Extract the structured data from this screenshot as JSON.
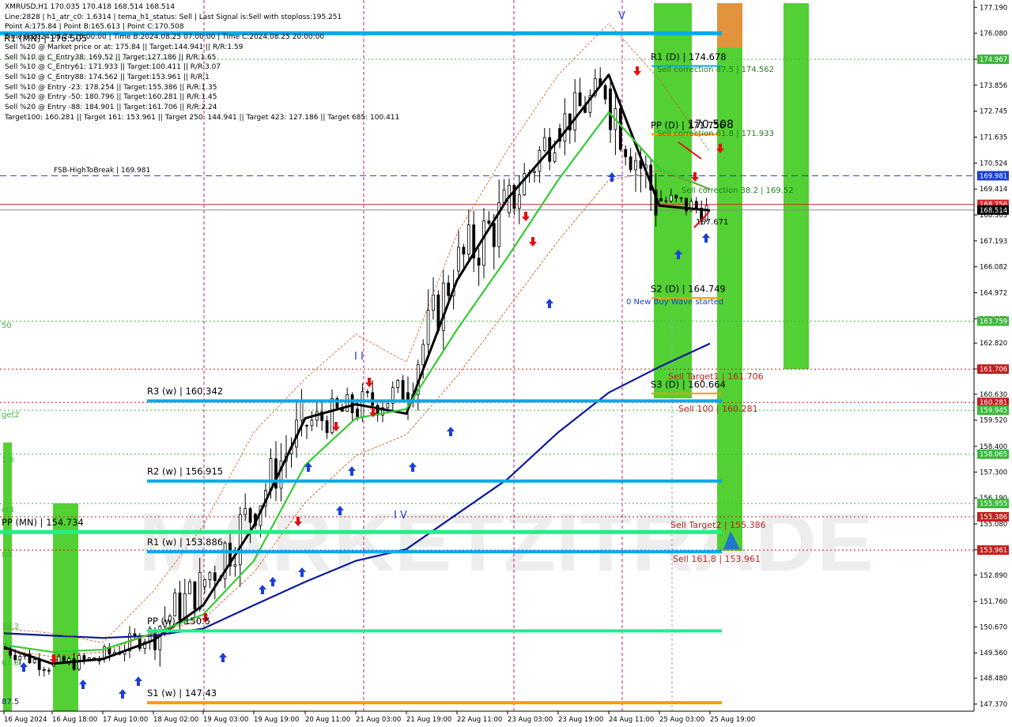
{
  "info": {
    "lines": [
      "XMRUSD,H1  170.035 170.418 168.514 168.514",
      "Line:2828  |  h1_atr_c0: 1.6314  |  tema_h1_status: Sell  |  Last Signal is:Sell with stoploss:195.251",
      "Point A:175.84  |  Point B:165.613  |  Point C:170.508",
      "Time A:2024.08.24 15:00:00  |  Time B:2024.08.25 07:00:00  |  Time C:2024.08.25 20:00:00",
      "Sell %20 @ Market price or at: 175.84  ||  Target:144.941  ||  R/R:1.59",
      "Sell %10 @ C_Entry38: 169.52  ||  Target:127.186  ||  R/R:1.65",
      "Sell %10 @ C_Entry61: 171.933  ||  Target:100.411  ||  R/R:3.07",
      "Sell %10 @ C_Entry88: 174.562  ||  Target:153.961  ||  R/R:1",
      "Sell %10 @ Entry -23: 178.254  ||  Target:155.386  ||  R/R:1.35",
      "Sell %20 @ Entry -50: 180.796  ||  Target:160.281  ||  R/R:1.45",
      "Sell %20 @ Entry -88: 184.901  ||  Target:161.706  ||  R/R:2.24",
      "Target100: 160.281  ||  Target 161: 153.961  ||  Target 250: 144.941  ||  Target 423: 127.186  ||  Target 685: 100.411"
    ]
  },
  "watermark": "MARKETZITRADE",
  "price_axis": {
    "ticks": [
      "177.190",
      "176.080",
      "174.967",
      "173.856",
      "172.745",
      "171.635",
      "170.524",
      "169.414",
      "168.303",
      "167.193",
      "166.082",
      "164.972",
      "163.861",
      "162.820",
      "161.710",
      "160.630",
      "159.520",
      "158.400",
      "157.300",
      "156.190",
      "155.080",
      "153.970",
      "152.890",
      "151.760",
      "150.670",
      "149.560",
      "148.480",
      "147.370"
    ],
    "badges": [
      {
        "text": "174.967",
        "price": 174.967,
        "color": "#3cb83c"
      },
      {
        "text": "169.981",
        "price": 169.981,
        "color": "#1a3fd6"
      },
      {
        "text": "168.756",
        "price": 168.756,
        "color": "#d42a2a"
      },
      {
        "text": "168.514",
        "price": 168.514,
        "color": "#000000"
      },
      {
        "text": "163.759",
        "price": 163.759,
        "color": "#3cb83c"
      },
      {
        "text": "161.706",
        "price": 161.706,
        "color": "#c41e1e"
      },
      {
        "text": "160.281",
        "price": 160.281,
        "color": "#c41e1e"
      },
      {
        "text": "159.945",
        "price": 159.945,
        "color": "#3cb83c"
      },
      {
        "text": "158.065",
        "price": 158.065,
        "color": "#3cb83c"
      },
      {
        "text": "155.955",
        "price": 155.955,
        "color": "#3cb83c"
      },
      {
        "text": "155.386",
        "price": 155.386,
        "color": "#c41e1e"
      },
      {
        "text": "153.961",
        "price": 153.961,
        "color": "#c41e1e"
      }
    ]
  },
  "time_axis": {
    "labels": [
      "16 Aug 2024",
      "16 Aug 18:00",
      "17 Aug 10:00",
      "18 Aug 02:00",
      "19 Aug 03:00",
      "19 Aug 19:00",
      "20 Aug 11:00",
      "21 Aug 03:00",
      "21 Aug 19:00",
      "22 Aug 11:00",
      "23 Aug 03:00",
      "23 Aug 19:00",
      "24 Aug 11:00",
      "25 Aug 03:00",
      "25 Aug 19:00"
    ]
  },
  "levels": [
    {
      "label": "R1 (MN) | 176.505",
      "price": 176.08,
      "style": "cyan-thick"
    },
    {
      "label": "FSB-HighToBreak | 169.981",
      "price": 169.981,
      "style": "blue-dash"
    },
    {
      "label": "R3 (w) | 160.342",
      "price": 160.342,
      "style": "cyan-thick"
    },
    {
      "label": "R2 (w) | 156.915",
      "price": 156.915,
      "style": "cyan-thick"
    },
    {
      "label": "PP (MN) | 154.734",
      "price": 154.734,
      "style": "green-thick"
    },
    {
      "label": "R1 (w) | 153.886",
      "price": 153.886,
      "style": "cyan-thick"
    },
    {
      "label": "PP (w) | 150.5",
      "price": 150.5,
      "style": "green-thick"
    },
    {
      "label": "S1 (w) | 147.43",
      "price": 147.43,
      "style": "orange-thick"
    },
    {
      "label": "R1 (D) | 174.678",
      "price": 174.678,
      "style": "daily"
    },
    {
      "label": "PP (D) | 171.756",
      "price": 171.756,
      "style": "daily"
    },
    {
      "label": "S2 (D) | 164.749",
      "price": 164.749,
      "style": "daily"
    },
    {
      "label": "S3 (D) | 160.664",
      "price": 160.664,
      "style": "daily"
    }
  ],
  "annotations": [
    {
      "text": "Sell correction 87.5 | 174.562",
      "color": "#1e7d1e"
    },
    {
      "text": "Sell correction 61.8 | 171.933",
      "color": "#1e7d1e"
    },
    {
      "text": "170.508",
      "color": "#000000"
    },
    {
      "text": "Sell correction 38.2 | 169.52",
      "color": "#1e7d1e"
    },
    {
      "text": "167.671",
      "color": "#000000"
    },
    {
      "text": "0 New Buy Wave started",
      "color": "#1a3fd6"
    },
    {
      "text": "Sell Target1 | 161.706",
      "color": "#c41e1e"
    },
    {
      "text": "Sell 100 | 160.281",
      "color": "#c41e1e"
    },
    {
      "text": "Sell Target2 | 155.386",
      "color": "#c41e1e"
    },
    {
      "text": "Sell 161.8 | 153.961",
      "color": "#c41e1e"
    }
  ],
  "left_edge_labels": [
    "50",
    "get2",
    "1.8",
    "et1",
    "00",
    "38.2",
    "61.8",
    "87.5"
  ],
  "wave_labels": [
    "V",
    "I I",
    "I V"
  ],
  "colors": {
    "cyan": "#00aaee",
    "green_bar": "#44cc22",
    "green_line": "#22dd77",
    "orange": "#ff9900",
    "blue_ma": "#0a1a99",
    "green_ma": "#33cc33",
    "black_ma": "#000000",
    "candle": "#000000"
  },
  "chart_data": {
    "type": "line",
    "title": "XMRUSD,H1",
    "xlabel": "",
    "ylabel": "",
    "ylim": [
      147.2,
      177.3
    ],
    "x": [
      "16 Aug 2024",
      "16 Aug 18:00",
      "17 Aug 10:00",
      "18 Aug 02:00",
      "19 Aug 03:00",
      "19 Aug 19:00",
      "20 Aug 11:00",
      "21 Aug 03:00",
      "21 Aug 19:00",
      "22 Aug 11:00",
      "23 Aug 03:00",
      "23 Aug 19:00",
      "24 Aug 11:00",
      "25 Aug 03:00",
      "25 Aug 19:00"
    ],
    "series": [
      {
        "values": [
          149.8,
          149.1,
          149.3,
          150.1,
          151.6,
          155.0,
          159.6,
          160.2,
          159.8,
          165.5,
          169.0,
          171.5,
          174.3,
          168.7,
          168.5
        ]
      },
      {
        "values": [
          150.4,
          150.3,
          150.2,
          150.3,
          150.6,
          151.6,
          152.6,
          153.5,
          154.0,
          155.5,
          157.0,
          159.0,
          160.7,
          161.8,
          162.8
        ]
      },
      {
        "values": [
          149.9,
          149.6,
          149.7,
          150.4,
          151.2,
          153.5,
          157.6,
          159.6,
          160.0,
          163.4,
          166.5,
          169.8,
          172.7,
          170.3,
          169.4
        ]
      },
      {
        "values": [
          149.7,
          149.4,
          149.6,
          150.4,
          151.0,
          153.0,
          156.0,
          158.0,
          158.9,
          161.4,
          164.3,
          167.2,
          169.8,
          170.2,
          169.4
        ]
      }
    ],
    "candles": [
      {
        "x": "16 Aug 2024",
        "o": 149.5,
        "h": 150.1,
        "l": 149.2,
        "c": 149.8
      },
      {
        "x": "16 Aug 18:00",
        "o": 149.6,
        "h": 149.9,
        "l": 148.4,
        "c": 149.0
      },
      {
        "x": "17 Aug 10:00",
        "o": 149.0,
        "h": 149.5,
        "l": 148.5,
        "c": 149.3
      },
      {
        "x": "18 Aug 02:00",
        "o": 149.4,
        "h": 151.7,
        "l": 149.2,
        "c": 150.4
      },
      {
        "x": "19 Aug 03:00",
        "o": 150.5,
        "h": 154.5,
        "l": 149.4,
        "c": 152.4
      },
      {
        "x": "19 Aug 19:00",
        "o": 152.0,
        "h": 158.5,
        "l": 151.5,
        "c": 155.5
      },
      {
        "x": "20 Aug 11:00",
        "o": 155.8,
        "h": 160.8,
        "l": 155.0,
        "c": 159.3
      },
      {
        "x": "21 Aug 03:00",
        "o": 159.5,
        "h": 162.7,
        "l": 158.6,
        "c": 160.0
      },
      {
        "x": "21 Aug 19:00",
        "o": 159.8,
        "h": 161.5,
        "l": 157.4,
        "c": 160.7
      },
      {
        "x": "22 Aug 11:00",
        "o": 161.0,
        "h": 167.0,
        "l": 160.4,
        "c": 165.9
      },
      {
        "x": "23 Aug 03:00",
        "o": 166.2,
        "h": 170.6,
        "l": 163.2,
        "c": 168.4
      },
      {
        "x": "23 Aug 19:00",
        "o": 168.6,
        "h": 173.8,
        "l": 168.0,
        "c": 172.0
      },
      {
        "x": "24 Aug 11:00",
        "o": 172.2,
        "h": 176.0,
        "l": 171.2,
        "c": 173.7
      },
      {
        "x": "25 Aug 03:00",
        "o": 173.4,
        "h": 173.6,
        "l": 165.6,
        "c": 169.0
      },
      {
        "x": "25 Aug 19:00",
        "o": 169.0,
        "h": 170.5,
        "l": 167.6,
        "c": 168.5
      }
    ]
  }
}
